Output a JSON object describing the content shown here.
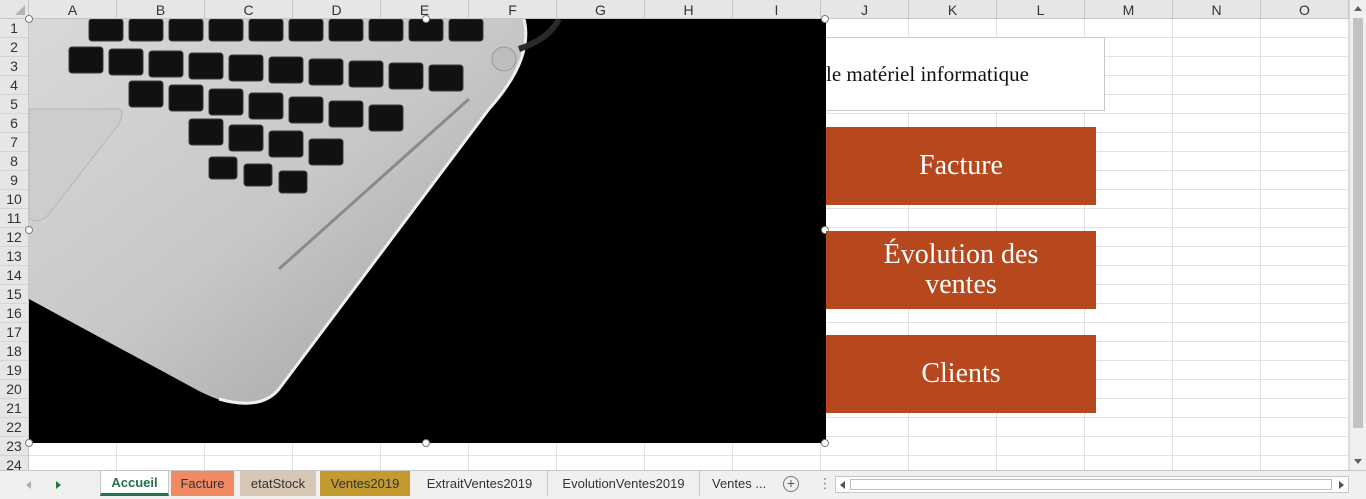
{
  "sheet": {
    "columns": [
      "A",
      "B",
      "C",
      "D",
      "E",
      "F",
      "G",
      "H",
      "I",
      "J",
      "K",
      "L",
      "M",
      "N",
      "O"
    ],
    "rows": [
      "1",
      "2",
      "3",
      "4",
      "5",
      "6",
      "7",
      "8",
      "9",
      "10",
      "11",
      "12",
      "13",
      "14",
      "15",
      "16",
      "17",
      "18",
      "19",
      "20",
      "21",
      "22",
      "23",
      "24"
    ]
  },
  "title": "le matériel informatique",
  "buttons": {
    "facture": "Facture",
    "evolution": "Évolution des ventes",
    "clients": "Clients"
  },
  "tabs": [
    {
      "label": "Accueil",
      "color": "#ffffff"
    },
    {
      "label": "Facture",
      "color": "#ef8a63"
    },
    {
      "label": "etatStock",
      "color": "#d6c8b4"
    },
    {
      "label": "Ventes2019",
      "color": "#c29a30"
    },
    {
      "label": "ExtraitVentes2019",
      "color": ""
    },
    {
      "label": "EvolutionVentes2019",
      "color": ""
    },
    {
      "label": "Ventes ...",
      "color": ""
    }
  ],
  "colors": {
    "button_bg": "#b7471c",
    "active_tab_text": "#217346"
  },
  "icons": {
    "add_sheet": "+",
    "more": "⋮"
  }
}
